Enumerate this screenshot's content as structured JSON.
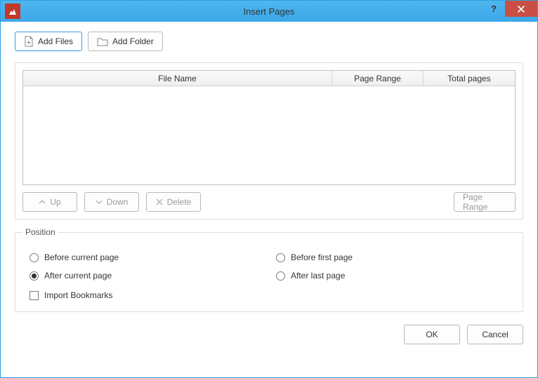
{
  "window": {
    "title": "Insert Pages"
  },
  "toolbar": {
    "add_files_label": "Add Files",
    "add_folder_label": "Add Folder"
  },
  "table": {
    "columns": {
      "file_name": "File Name",
      "page_range": "Page Range",
      "total_pages": "Total pages"
    },
    "rows": []
  },
  "file_actions": {
    "up_label": "Up",
    "down_label": "Down",
    "delete_label": "Delete",
    "page_range_label": "Page Range"
  },
  "position": {
    "legend": "Position",
    "options": {
      "before_current": "Before current page",
      "before_first": "Before first page",
      "after_current": "After current page",
      "after_last": "After last page"
    },
    "selected": "after_current",
    "import_bookmarks_label": "Import Bookmarks",
    "import_bookmarks_checked": false
  },
  "footer": {
    "ok_label": "OK",
    "cancel_label": "Cancel"
  }
}
